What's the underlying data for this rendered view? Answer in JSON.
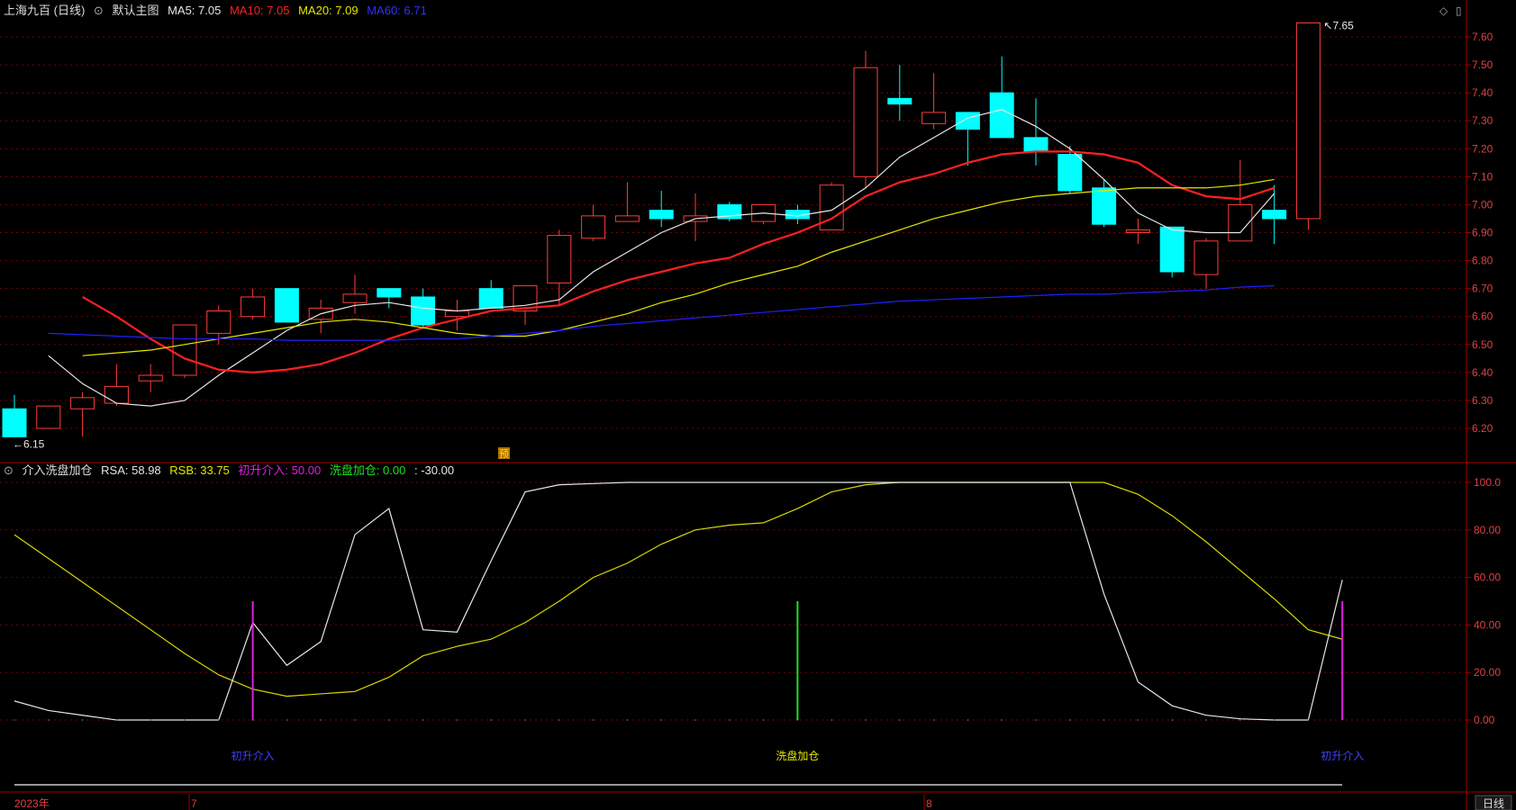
{
  "header": {
    "stock_title": "上海九百 (日线)",
    "main_chart_label": "默认主图",
    "ma5_label": "MA5: 7.05",
    "ma10_label": "MA10: 7.05",
    "ma20_label": "MA20: 7.09",
    "ma60_label": "MA60: 6.71",
    "diamond_icon": "diamond-icon",
    "panel_icon": "panel-toggle-icon"
  },
  "sub_header": {
    "indicator_name": "介入洗盘加仓",
    "rsa_label": "RSA: 58.98",
    "rsb_label": "RSB: 33.75",
    "chushen_label": "初升介入: 50.00",
    "xipan_label": "洗盘加仓: 0.00",
    "extra_label": ": -30.00"
  },
  "colors": {
    "up": "#ff3b3b",
    "down": "#00ffff",
    "ma5": "#e6e6e6",
    "ma10": "#ff2020",
    "ma20": "#e6e600",
    "ma60": "#2020ff",
    "grid": "#7a0000",
    "axis": "#a00000",
    "rsa": "#e6e6e6",
    "rsb": "#d8d800",
    "signal_buy": "#e020e0",
    "signal_add": "#20e020",
    "signal_text_buy": "#4040ff",
    "signal_text_add": "#e6e600"
  },
  "footer": {
    "year_label": "2023年",
    "month_7": "7",
    "month_8": "8",
    "period_button": "日线"
  },
  "chart_data": [
    {
      "type": "candlestick",
      "y_ticks": [
        "7.60",
        "7.50",
        "7.40",
        "7.30",
        "7.20",
        "7.10",
        "7.00",
        "6.90",
        "6.80",
        "6.70",
        "6.60",
        "6.50",
        "6.40",
        "6.30",
        "6.20"
      ],
      "ylim": [
        6.13,
        7.68
      ],
      "marker_high": "7.65",
      "marker_low": "6.15",
      "annotation": "预",
      "candles": [
        {
          "o": 6.27,
          "h": 6.32,
          "l": 6.17,
          "c": 6.17
        },
        {
          "o": 6.2,
          "h": 6.28,
          "l": 6.2,
          "c": 6.28
        },
        {
          "o": 6.27,
          "h": 6.33,
          "l": 6.17,
          "c": 6.31
        },
        {
          "o": 6.29,
          "h": 6.43,
          "l": 6.28,
          "c": 6.35
        },
        {
          "o": 6.37,
          "h": 6.43,
          "l": 6.33,
          "c": 6.39
        },
        {
          "o": 6.39,
          "h": 6.57,
          "l": 6.38,
          "c": 6.57
        },
        {
          "o": 6.54,
          "h": 6.64,
          "l": 6.5,
          "c": 6.62
        },
        {
          "o": 6.6,
          "h": 6.7,
          "l": 6.59,
          "c": 6.67
        },
        {
          "o": 6.7,
          "h": 6.7,
          "l": 6.58,
          "c": 6.58
        },
        {
          "o": 6.59,
          "h": 6.66,
          "l": 6.54,
          "c": 6.63
        },
        {
          "o": 6.65,
          "h": 6.75,
          "l": 6.61,
          "c": 6.68
        },
        {
          "o": 6.7,
          "h": 6.7,
          "l": 6.63,
          "c": 6.67
        },
        {
          "o": 6.67,
          "h": 6.7,
          "l": 6.56,
          "c": 6.57
        },
        {
          "o": 6.6,
          "h": 6.66,
          "l": 6.55,
          "c": 6.62
        },
        {
          "o": 6.7,
          "h": 6.73,
          "l": 6.63,
          "c": 6.63
        },
        {
          "o": 6.62,
          "h": 6.71,
          "l": 6.57,
          "c": 6.71
        },
        {
          "o": 6.72,
          "h": 6.91,
          "l": 6.64,
          "c": 6.89
        },
        {
          "o": 6.88,
          "h": 7.0,
          "l": 6.87,
          "c": 6.96
        },
        {
          "o": 6.94,
          "h": 7.08,
          "l": 6.94,
          "c": 6.96
        },
        {
          "o": 6.98,
          "h": 7.05,
          "l": 6.92,
          "c": 6.95
        },
        {
          "o": 6.94,
          "h": 7.04,
          "l": 6.87,
          "c": 6.96
        },
        {
          "o": 7.0,
          "h": 7.01,
          "l": 6.94,
          "c": 6.95
        },
        {
          "o": 6.94,
          "h": 7.0,
          "l": 6.93,
          "c": 7.0
        },
        {
          "o": 6.98,
          "h": 7.0,
          "l": 6.93,
          "c": 6.95
        },
        {
          "o": 6.91,
          "h": 7.08,
          "l": 6.91,
          "c": 7.07
        },
        {
          "o": 7.1,
          "h": 7.55,
          "l": 7.06,
          "c": 7.49
        },
        {
          "o": 7.38,
          "h": 7.5,
          "l": 7.3,
          "c": 7.36
        },
        {
          "o": 7.29,
          "h": 7.47,
          "l": 7.27,
          "c": 7.33
        },
        {
          "o": 7.33,
          "h": 7.33,
          "l": 7.14,
          "c": 7.27
        },
        {
          "o": 7.4,
          "h": 7.53,
          "l": 7.24,
          "c": 7.24
        },
        {
          "o": 7.24,
          "h": 7.38,
          "l": 7.14,
          "c": 7.19
        },
        {
          "o": 7.18,
          "h": 7.21,
          "l": 7.04,
          "c": 7.05
        },
        {
          "o": 7.06,
          "h": 7.09,
          "l": 6.92,
          "c": 6.93
        },
        {
          "o": 6.9,
          "h": 6.95,
          "l": 6.86,
          "c": 6.91
        },
        {
          "o": 6.92,
          "h": 6.92,
          "l": 6.74,
          "c": 6.76
        },
        {
          "o": 6.75,
          "h": 6.88,
          "l": 6.7,
          "c": 6.87
        },
        {
          "o": 6.87,
          "h": 7.16,
          "l": 6.87,
          "c": 7.0
        },
        {
          "o": 6.98,
          "h": 7.07,
          "l": 6.86,
          "c": 6.95
        },
        {
          "o": 6.95,
          "h": 7.65,
          "l": 6.91,
          "c": 7.65
        }
      ],
      "series": [
        {
          "name": "MA5",
          "values": [
            6.46,
            6.36,
            6.29,
            6.28,
            6.3,
            6.39,
            6.47,
            6.55,
            6.61,
            6.64,
            6.65,
            6.63,
            6.62,
            6.63,
            6.64,
            6.66,
            6.76,
            6.83,
            6.9,
            6.95,
            6.96,
            6.97,
            6.96,
            6.98,
            7.06,
            7.17,
            7.24,
            7.31,
            7.34,
            7.28,
            7.2,
            7.09,
            6.97,
            6.91,
            6.9,
            6.9,
            7.04
          ]
        },
        {
          "name": "MA10",
          "values": [
            6.67,
            6.6,
            6.52,
            6.45,
            6.41,
            6.4,
            6.41,
            6.43,
            6.47,
            6.52,
            6.56,
            6.59,
            6.62,
            6.63,
            6.64,
            6.69,
            6.73,
            6.76,
            6.79,
            6.81,
            6.86,
            6.9,
            6.95,
            7.03,
            7.08,
            7.11,
            7.15,
            7.18,
            7.19,
            7.19,
            7.18,
            7.15,
            7.07,
            7.03,
            7.02,
            7.06
          ]
        },
        {
          "name": "MA20",
          "values": [
            6.46,
            6.47,
            6.48,
            6.5,
            6.52,
            6.54,
            6.56,
            6.58,
            6.59,
            6.58,
            6.56,
            6.54,
            6.53,
            6.53,
            6.55,
            6.58,
            6.61,
            6.65,
            6.68,
            6.72,
            6.75,
            6.78,
            6.83,
            6.87,
            6.91,
            6.95,
            6.98,
            7.01,
            7.03,
            7.04,
            7.05,
            7.06,
            7.06,
            7.06,
            7.07,
            7.09
          ]
        },
        {
          "name": "MA60",
          "values": [
            6.54,
            6.535,
            6.53,
            6.525,
            6.52,
            6.52,
            6.52,
            6.515,
            6.515,
            6.515,
            6.515,
            6.52,
            6.52,
            6.53,
            6.54,
            6.55,
            6.565,
            6.575,
            6.585,
            6.595,
            6.605,
            6.615,
            6.625,
            6.635,
            6.645,
            6.655,
            6.66,
            6.665,
            6.67,
            6.675,
            6.68,
            6.68,
            6.685,
            6.69,
            6.695,
            6.705,
            6.71
          ]
        }
      ]
    },
    {
      "type": "line",
      "title": "介入洗盘加仓",
      "y_ticks": [
        "100.0",
        "80.00",
        "60.00",
        "40.00",
        "20.00",
        "0.00"
      ],
      "ylim": [
        0,
        100
      ],
      "series": [
        {
          "name": "RSA",
          "values": [
            8,
            4,
            2,
            0,
            0,
            0,
            0,
            41,
            23,
            33,
            78,
            89,
            38,
            37,
            67,
            96,
            99,
            99.5,
            100,
            100,
            100,
            100,
            100,
            100,
            100,
            100,
            100,
            100,
            100,
            100,
            100,
            100,
            53,
            16,
            6,
            2,
            0.5,
            0,
            0,
            59
          ]
        },
        {
          "name": "RSB",
          "values": [
            78,
            68,
            58,
            48,
            38,
            28,
            19,
            13,
            10,
            11,
            12,
            18,
            27,
            31,
            34,
            41,
            50,
            60,
            66,
            74,
            80,
            82,
            83,
            89,
            96,
            99,
            100,
            100,
            100,
            100,
            100,
            100,
            100,
            95,
            86,
            75,
            63,
            51,
            38,
            34
          ]
        }
      ],
      "signals": [
        {
          "index": 7,
          "kind": "buy",
          "label": "初升介入"
        },
        {
          "index": 23,
          "kind": "add",
          "label": "洗盘加仓"
        },
        {
          "index": 39,
          "kind": "buy",
          "label": "初升介入"
        }
      ]
    }
  ]
}
